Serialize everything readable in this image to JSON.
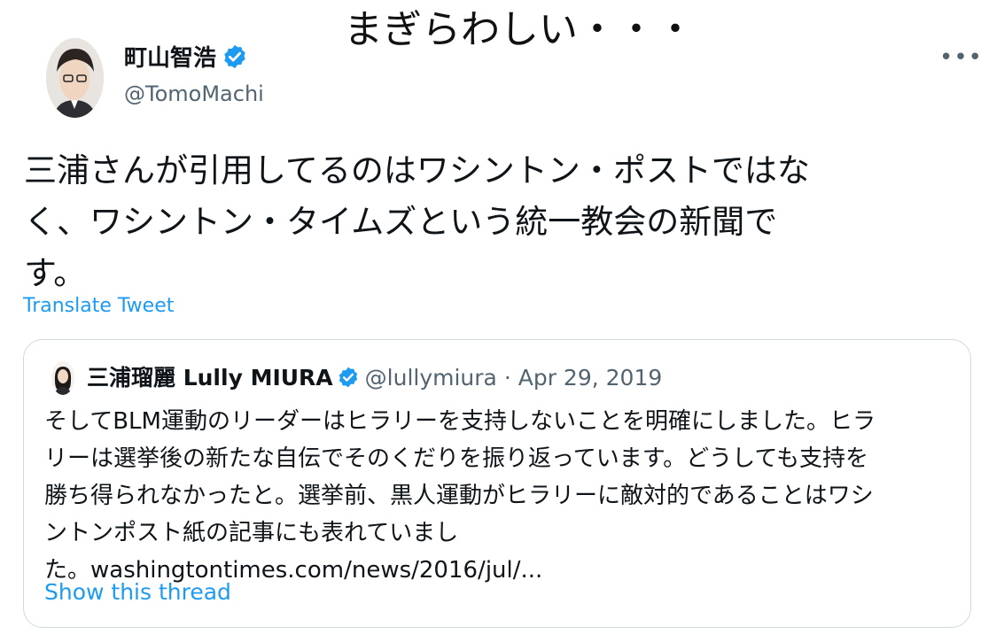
{
  "overlay_caption": "まぎらわしい・・・",
  "tweet": {
    "author_name": "町山智浩",
    "author_handle": "@TomoMachi",
    "more_label": "•••",
    "text_lines": [
      "三浦さんが引用してるのはワシントン・ポストではな",
      "く、ワシントン・タイムズという統一教会の新聞で",
      "す。"
    ],
    "translate_label": "Translate Tweet"
  },
  "quoted_tweet": {
    "author_name": "三浦瑠麗 Lully MIURA",
    "author_handle": "@lullymiura",
    "separator": "·",
    "date": "Apr 29, 2019",
    "text_lines": [
      "そしてBLM運動のリーダーはヒラリーを支持しないことを明確にしました。ヒラ",
      "リーは選挙後の新たな自伝でそのくだりを振り返っています。どうしても支持を",
      "勝ち得られなかったと。選挙前、黒人運動がヒラリーに敵対的であることはワシ",
      "ントンポスト紙の記事にも表れていまし",
      "た。washingtontimes.com/news/2016/jul/..."
    ],
    "show_thread_label": "Show this thread"
  },
  "colors": {
    "link_blue": "#1d9bf0",
    "secondary_text": "#536471",
    "border": "#cfd9de",
    "verified_blue": "#1d9bf0"
  },
  "icons": {
    "verified": "verified-badge-icon",
    "more": "more-options-icon"
  }
}
